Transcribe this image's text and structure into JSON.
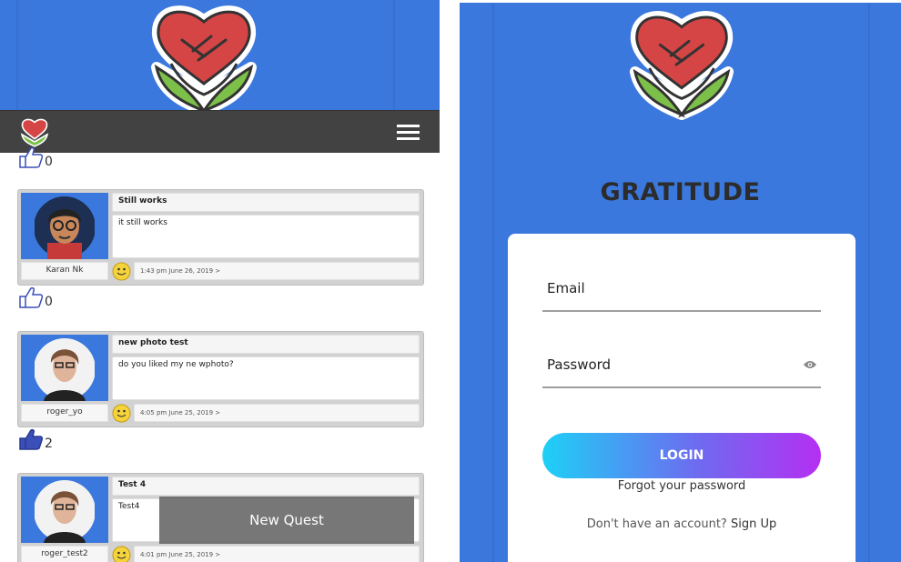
{
  "left_panel": {
    "top_like_count": "0",
    "posts": [
      {
        "title": "Still works",
        "body": "it still works",
        "username": "Karan Nk",
        "meta": "1:43 pm June 26, 2019 >",
        "like_count": "0"
      },
      {
        "title": "new photo test",
        "body": "do you liked my ne wphoto?",
        "username": "roger_yo",
        "meta": "4:05 pm June 25, 2019 >",
        "like_count": "2"
      },
      {
        "title": "Test 4",
        "body": "Test4",
        "username": "roger_test2",
        "meta": "4:01 pm June 25, 2019 >"
      }
    ],
    "new_quest_label": "New Quest"
  },
  "right_panel": {
    "app_title": "GRATITUDE",
    "email_placeholder": "Email",
    "password_placeholder": "Password",
    "login_label": "LOGIN",
    "forgot_label": "Forgot your password",
    "signup_prompt": "Don't have an account?",
    "signup_label": "Sign Up"
  },
  "colors": {
    "brand_blue": "#3b78dd",
    "navbar": "#424242",
    "liked_thumb": "#3b4fb8",
    "login_gradient": [
      "#1ed0f6",
      "#b52ff2"
    ]
  },
  "icons": [
    "handshake-logo-icon",
    "hamburger-menu-icon",
    "thumbs-up-icon",
    "smiley-icon",
    "eye-icon"
  ]
}
